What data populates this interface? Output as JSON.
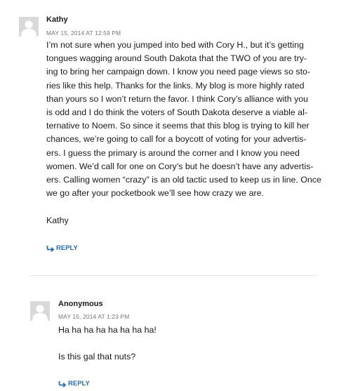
{
  "comments": [
    {
      "author": "Kathy",
      "date": "MAY 15, 2014 AT 12:59 PM",
      "lines": [
        "I’m not sure when you jumped into bed with Cory H., but it’s getting",
        "tongues wagging around South Dakota that the TWO of you are try-",
        "ing to bring her campaign down. I know you need page views so sto-",
        "ries like this help. Thanks for the links. My blog is more highly rated",
        "than yours so I won’t return the favor. I think Cory’s alliance with you",
        "is odd and I do think the voters of South Dakota deserve a viable al-",
        "ternative to Noem. So since it seems that this blog is trying to kill her",
        "chances, we’re going to call for a boycott of voting for your advertis-",
        "ers. I guess the primary is around the corner and I know you need",
        "women. We’d call for one on Cory’s but he doesn’t have any advertis-",
        "ers. Calling women “crazy” is an old tactic used to keep us in line. Once",
        "we go after your pocketbook we’ll see how crazy we are."
      ],
      "signature": "Kathy",
      "reply_label": "REPLY"
    },
    {
      "author": "Anonymous",
      "date": "MAY 15, 2014 AT 1:23 PM",
      "line1": "Ha ha ha ha ha ha ha ha!",
      "line2": "Is this gal that nuts?",
      "reply_label": "REPLY"
    }
  ],
  "colors": {
    "link": "#2a6cb0",
    "meta": "#767676",
    "avatar_bg": "#d9d9d9"
  },
  "icons": {
    "avatar": "default-avatar-icon",
    "reply": "reply-arrow-icon"
  }
}
